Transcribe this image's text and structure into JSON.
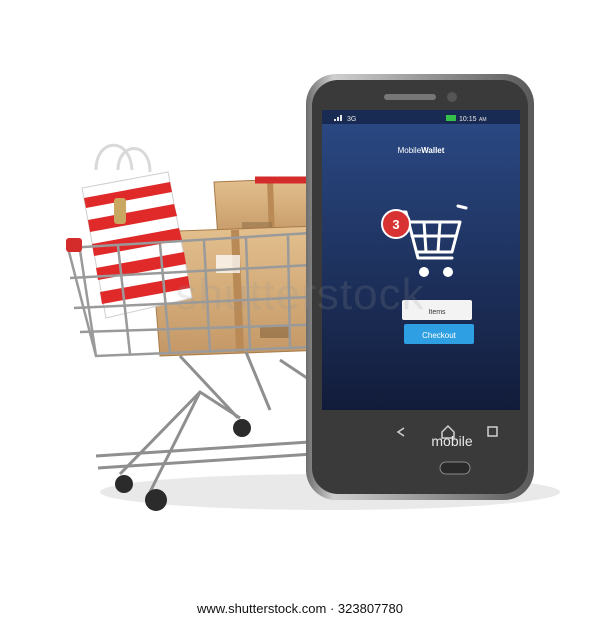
{
  "phone": {
    "status_signal": "3G",
    "status_time": "10:15",
    "status_ampm": "AM",
    "app_title_prefix": "Mobile",
    "app_title_bold": "Wallet",
    "cart_count": "3",
    "items_label": "Items",
    "checkout_label": "Checkout",
    "brand_label": "mobile"
  },
  "watermark": "shutterstock",
  "credit": {
    "site": "www.shutterstock.com",
    "separator": " · ",
    "image_id": "323807780"
  },
  "colors": {
    "screen_top": "#2b4a86",
    "screen_bottom": "#121c3a",
    "badge": "#d83232",
    "checkout": "#2f9fe3",
    "bag_red": "#e02a2a",
    "box_tan": "#d8b07a"
  }
}
